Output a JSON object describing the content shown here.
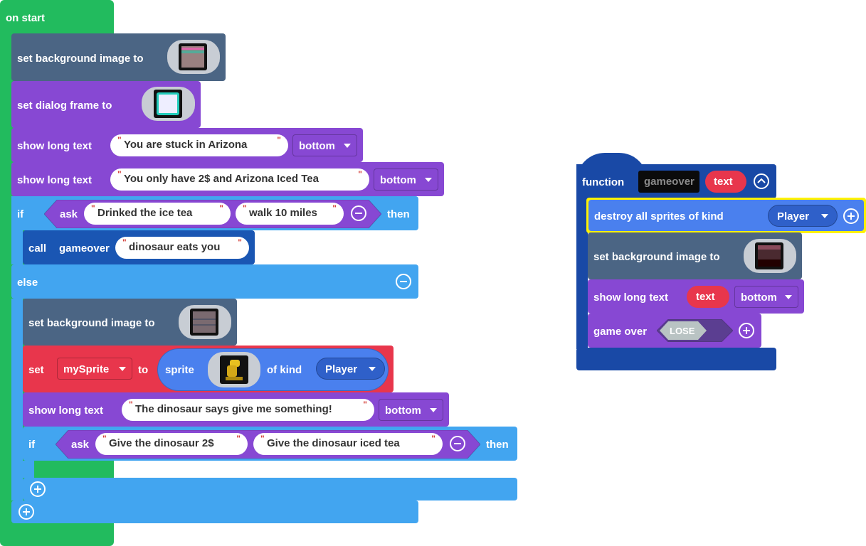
{
  "on_start": {
    "hat_label": "on start",
    "set_background": {
      "label": "set background image to",
      "image": "background-image-thumbnail"
    },
    "set_dialog_frame": {
      "label": "set dialog frame to",
      "image": "dialog-frame-thumbnail"
    },
    "show_text_1": {
      "label": "show long text",
      "text": "You are stuck in Arizona",
      "position": "bottom"
    },
    "show_text_2": {
      "label": "show long text",
      "text": "You only have 2$ and Arizona Iced Tea",
      "position": "bottom"
    },
    "if_1": {
      "if_label": "if",
      "ask_label": "ask",
      "option_a": "Drinked the ice tea",
      "option_b": "walk 10 miles",
      "then_label": "then",
      "call": {
        "label": "call",
        "function": "gameover",
        "text": "dinosaur eats you"
      },
      "else_label": "else"
    },
    "else_branch": {
      "set_background": {
        "label": "set background image to",
        "image": "background-image-thumbnail"
      },
      "set_sprite": {
        "set_label": "set",
        "variable": "mySprite",
        "to_label": "to",
        "sprite_label": "sprite",
        "image": "dinosaur-sprite-image",
        "kind_label": "of kind",
        "kind": "Player"
      },
      "show_text": {
        "label": "show long text",
        "text": "The dinosaur says give me something!",
        "position": "bottom"
      },
      "if_2": {
        "if_label": "if",
        "ask_label": "ask",
        "option_a": "Give the dinosaur 2$",
        "option_b": "Give the dinosaur iced tea",
        "then_label": "then"
      }
    }
  },
  "function_def": {
    "label": "function",
    "name": "gameover",
    "param": "text",
    "destroy": {
      "label": "destroy all sprites of kind",
      "kind": "Player"
    },
    "set_background": {
      "label": "set background image to",
      "image": "background-image-thumbnail"
    },
    "show_text": {
      "label": "show long text",
      "param": "text",
      "position": "bottom"
    },
    "game_over": {
      "label": "game over",
      "result": "LOSE"
    }
  },
  "colors": {
    "events": "#22bb5e",
    "scene": "#4b6584",
    "game": "#8748d3",
    "logic": "#42a5f0",
    "functions": "#1949a6",
    "variables": "#e8364c",
    "sprites": "#4a80ee",
    "highlight": "#fff200"
  }
}
